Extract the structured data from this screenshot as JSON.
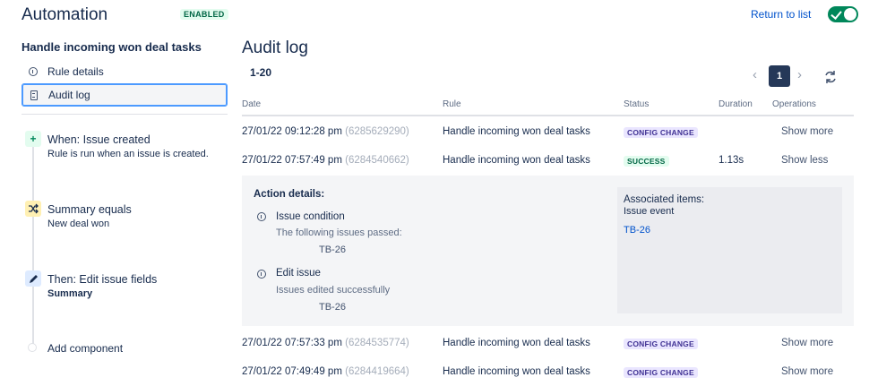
{
  "header": {
    "title": "Automation",
    "status_badge": "ENABLED",
    "return_link": "Return to list"
  },
  "sidebar": {
    "rule_name": "Handle incoming won deal tasks",
    "nav": [
      {
        "label": "Rule details",
        "icon": "info-icon"
      },
      {
        "label": "Audit log",
        "icon": "document-icon",
        "active": true
      }
    ],
    "components": [
      {
        "title": "When: Issue created",
        "subtitle": "Rule is run when an issue is created.",
        "icon": "plus-icon"
      },
      {
        "title": "Summary equals",
        "subtitle": "New deal won",
        "icon": "shuffle-icon"
      },
      {
        "title": "Then: Edit issue fields",
        "subtitle": "Summary",
        "icon": "pencil-icon"
      }
    ],
    "add_component": "Add component"
  },
  "main": {
    "title": "Audit log",
    "range": "1-20",
    "pagination": {
      "current": "1"
    },
    "columns": [
      "Date",
      "Rule",
      "Status",
      "Duration",
      "Operations"
    ],
    "rows": [
      {
        "date": "27/01/22 09:12:28 pm",
        "id": "(6285629290)",
        "rule": "Handle incoming won deal tasks",
        "status": "CONFIG CHANGE",
        "duration": "",
        "operation": "Show more"
      },
      {
        "date": "27/01/22 07:57:49 pm",
        "id": "(6284540662)",
        "rule": "Handle incoming won deal tasks",
        "status": "SUCCESS",
        "duration": "1.13s",
        "operation": "Show less"
      },
      {
        "date": "27/01/22 07:57:33 pm",
        "id": "(6284535774)",
        "rule": "Handle incoming won deal tasks",
        "status": "CONFIG CHANGE",
        "duration": "",
        "operation": "Show more"
      },
      {
        "date": "27/01/22 07:49:49 pm",
        "id": "(6284419664)",
        "rule": "Handle incoming won deal tasks",
        "status": "CONFIG CHANGE",
        "duration": "",
        "operation": "Show more"
      }
    ],
    "details": {
      "heading": "Action details:",
      "actions": [
        {
          "title": "Issue condition",
          "subtitle": "The following issues passed:",
          "key": "TB-26"
        },
        {
          "title": "Edit issue",
          "subtitle": "Issues edited successfully",
          "key": "TB-26"
        }
      ],
      "associated": {
        "title": "Associated items:",
        "subtitle": "Issue event",
        "link": "TB-26"
      }
    }
  },
  "colors": {
    "accent": "#0052cc",
    "toggle_on": "#00875a",
    "success": "#006644",
    "config_change": "#403294"
  }
}
